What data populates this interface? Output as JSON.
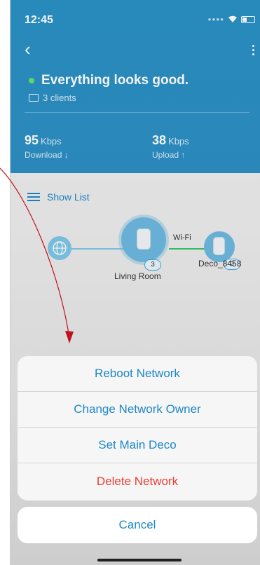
{
  "status_bar": {
    "time": "12:45"
  },
  "header": {
    "headline": "Everything looks good.",
    "clients": "3 clients",
    "download": {
      "value": "95",
      "unit": "Kbps",
      "label": "Download ↓"
    },
    "upload": {
      "value": "38",
      "unit": "Kbps",
      "label": "Upload ↑"
    }
  },
  "show_list": "Show List",
  "topology": {
    "link_label": "Wi-Fi",
    "main_node": {
      "name": "Living Room",
      "count": "3"
    },
    "satellite_node": {
      "name": "Deco_8458",
      "count": "0"
    }
  },
  "action_sheet": {
    "actions": [
      {
        "label": "Reboot Network"
      },
      {
        "label": "Change Network Owner"
      },
      {
        "label": "Set Main Deco"
      },
      {
        "label": "Delete Network"
      }
    ],
    "cancel": "Cancel"
  },
  "colors": {
    "header_blue": "#2a92c6",
    "action_blue": "#1e87c7",
    "danger_red": "#ec3b33",
    "status_green": "#5fe36a",
    "annotation_arrow": "#c0121a"
  }
}
